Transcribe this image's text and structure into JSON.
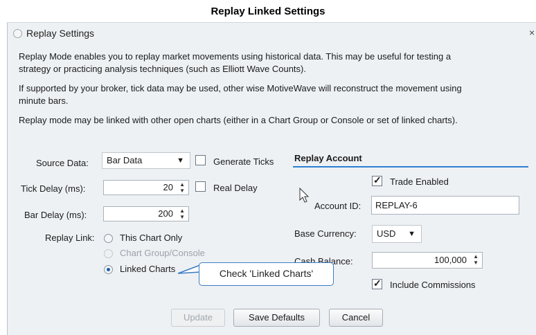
{
  "caption": "Replay Linked Settings",
  "window": {
    "title": "Replay Settings",
    "close": "×"
  },
  "paragraphs": {
    "p1_line1": "Replay Mode enables you to replay market movements using historical data. This may be useful for testing a",
    "p1_line2": "strategy or practicing analysis techniques (such as Elliott Wave Counts).",
    "p2_line1": "If supported by your broker, tick data may be used, other wise MotiveWave will reconstruct the movement using",
    "p2_line2": "minute bars.",
    "p3": "Replay mode may be linked with other open charts (either in a Chart Group or Console or set of linked charts)."
  },
  "left": {
    "source_label": "Source Data:",
    "source_value": "Bar Data",
    "generate_ticks": {
      "label": "Generate Ticks",
      "checked": false
    },
    "tick_delay_label": "Tick Delay (ms):",
    "tick_delay_value": "20",
    "real_delay": {
      "label": "Real Delay",
      "checked": false
    },
    "bar_delay_label": "Bar Delay (ms):",
    "bar_delay_value": "200",
    "replay_link_label": "Replay Link:",
    "options": [
      {
        "label": "This Chart Only",
        "selected": false,
        "enabled": true
      },
      {
        "label": "Chart Group/Console",
        "selected": false,
        "enabled": false
      },
      {
        "label": "Linked Charts",
        "selected": true,
        "enabled": true
      }
    ]
  },
  "account": {
    "section_title": "Replay Account",
    "trade_enabled": {
      "label": "Trade Enabled",
      "checked": true
    },
    "account_id_label": "Account ID:",
    "account_id_value": "REPLAY-6",
    "base_currency_label": "Base Currency:",
    "base_currency_value": "USD",
    "cash_balance_label": "Cash Balance:",
    "cash_balance_value": "100,000",
    "include_commissions": {
      "label": "Include Commissions",
      "checked": true
    }
  },
  "buttons": {
    "update": "Update",
    "save_defaults": "Save Defaults",
    "cancel": "Cancel"
  },
  "callout": "Check 'Linked Charts'",
  "colors": {
    "accent": "#2e7fcf",
    "dialog_bg": "#eef1f4",
    "callout_border": "#3b7cc4"
  }
}
